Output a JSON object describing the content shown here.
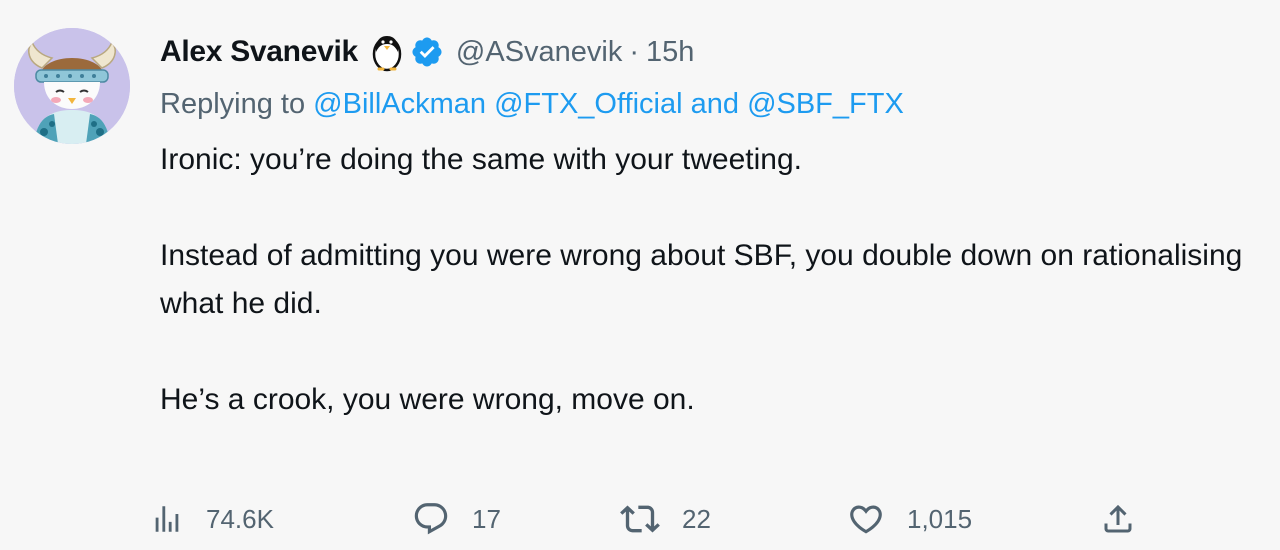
{
  "tweet": {
    "author": {
      "display_name": "Alex Svanevik",
      "handle": "@ASvanevik",
      "verified": true
    },
    "separator": "·",
    "time": "15h",
    "replying": {
      "prefix": "Replying to",
      "mention_1": "@BillAckman",
      "mention_2": "@FTX_Official",
      "conjunction": "and",
      "mention_3": "@SBF_FTX"
    },
    "body": {
      "line_1": "Ironic: you’re doing the same with your tweeting.",
      "line_2": "Instead of admitting you were wrong about SBF, you double down on rationalising what he did.",
      "line_3": "He’s a crook, you were wrong, move on."
    },
    "stats": {
      "views": "74.6K",
      "replies": "17",
      "retweets": "22",
      "likes": "1,015"
    }
  },
  "colors": {
    "accent": "#1d9bf0",
    "secondary_text": "#536471",
    "primary_text": "#0f1419",
    "background": "#f7f7f7"
  },
  "icons": [
    "avatar",
    "penguin-icon",
    "verified-badge-icon",
    "views-icon",
    "reply-icon",
    "retweet-icon",
    "like-icon",
    "share-icon"
  ]
}
